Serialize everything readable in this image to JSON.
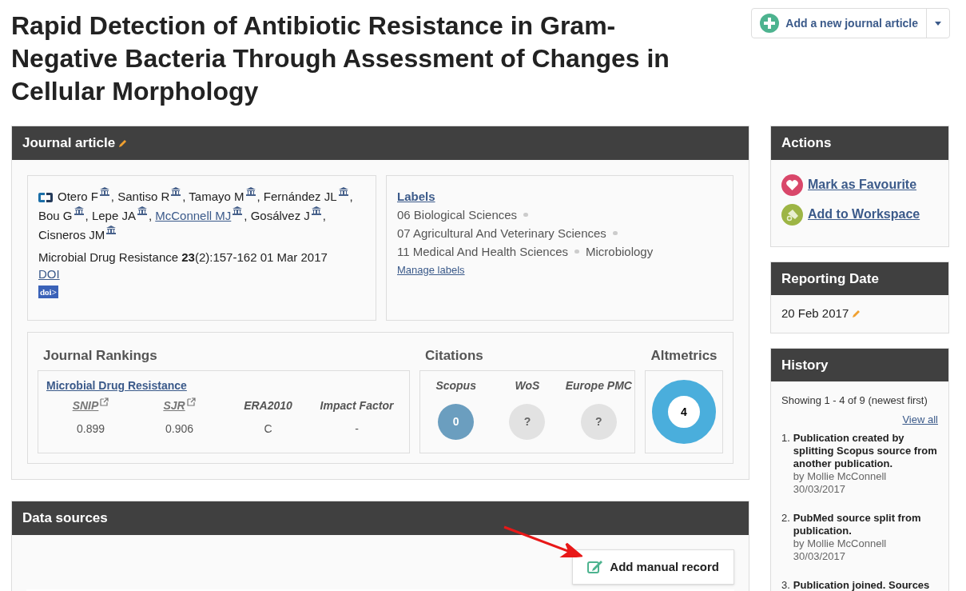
{
  "title": "Rapid Detection of Antibiotic Resistance in Gram-Negative Bacteria Through Assessment of Changes in Cellular Morphology",
  "add_button": {
    "label": "Add a new journal article"
  },
  "article": {
    "heading": "Journal article",
    "authors": [
      {
        "name": "Otero F",
        "link": false,
        "after": ","
      },
      {
        "name": "Santiso R",
        "link": false,
        "after": ","
      },
      {
        "name": "Tamayo M",
        "link": false,
        "after": ","
      },
      {
        "name": "Fernández JL",
        "link": false,
        "after": ","
      },
      {
        "name": "Bou G",
        "link": false,
        "after": ","
      },
      {
        "name": "Lepe JA",
        "link": false,
        "after": ","
      },
      {
        "name": "McConnell MJ",
        "link": true,
        "after": ","
      },
      {
        "name": "Gosálvez J",
        "link": false,
        "after": ","
      },
      {
        "name": "Cisneros JM",
        "link": false
      }
    ],
    "citation": "Microbial Drug Resistance **23**(2):157-162 01 Mar 2017",
    "doi_link": "DOI",
    "doi_badge": "doi>",
    "labels_heading": "Labels",
    "labels": [
      {
        "text": "06 Biological Sciences"
      },
      {
        "text": "07 Agricultural And Veterinary Sciences"
      },
      {
        "text": "11 Medical And Health Sciences",
        "sub": "Microbiology"
      }
    ],
    "manage_labels": "Manage labels",
    "rankings": {
      "heading": "Journal Rankings",
      "journal": "Microbial Drug Resistance",
      "columns": [
        {
          "label": "SNIP",
          "link": true,
          "value": "0.899"
        },
        {
          "label": "SJR",
          "link": true,
          "value": "0.906"
        },
        {
          "label": "ERA2010",
          "link": false,
          "value": "C"
        },
        {
          "label": "Impact Factor",
          "link": false,
          "value": "-"
        }
      ]
    },
    "citations": {
      "heading": "Citations",
      "sources": [
        {
          "name": "Scopus",
          "value": "0",
          "available": true
        },
        {
          "name": "WoS",
          "value": "?",
          "available": false
        },
        {
          "name": "Europe PMC",
          "value": "?",
          "available": false
        }
      ]
    },
    "altmetrics": {
      "heading": "Altmetrics",
      "score": "4"
    }
  },
  "data_sources": {
    "heading": "Data sources",
    "button": "Add manual record"
  },
  "actions": {
    "heading": "Actions",
    "items": [
      {
        "kind": "favourite",
        "label": "Mark as Favourite"
      },
      {
        "kind": "workspace",
        "label": "Add to Workspace"
      }
    ]
  },
  "reporting_date": {
    "heading": "Reporting Date",
    "value": "20 Feb 2017"
  },
  "history": {
    "heading": "History",
    "summary": "Showing 1 - 4 of 9 (newest first)",
    "view_all": "View all",
    "items": [
      {
        "number": "1.",
        "title": "Publication created by splitting Scopus source from another publication.",
        "by": "by Mollie McConnell",
        "date": "30/03/2017"
      },
      {
        "number": "2.",
        "title": "PubMed source split from publication.",
        "by": "by Mollie McConnell",
        "date": "30/03/2017"
      },
      {
        "number": "3.",
        "title": "Publication joined. Sources"
      }
    ]
  }
}
